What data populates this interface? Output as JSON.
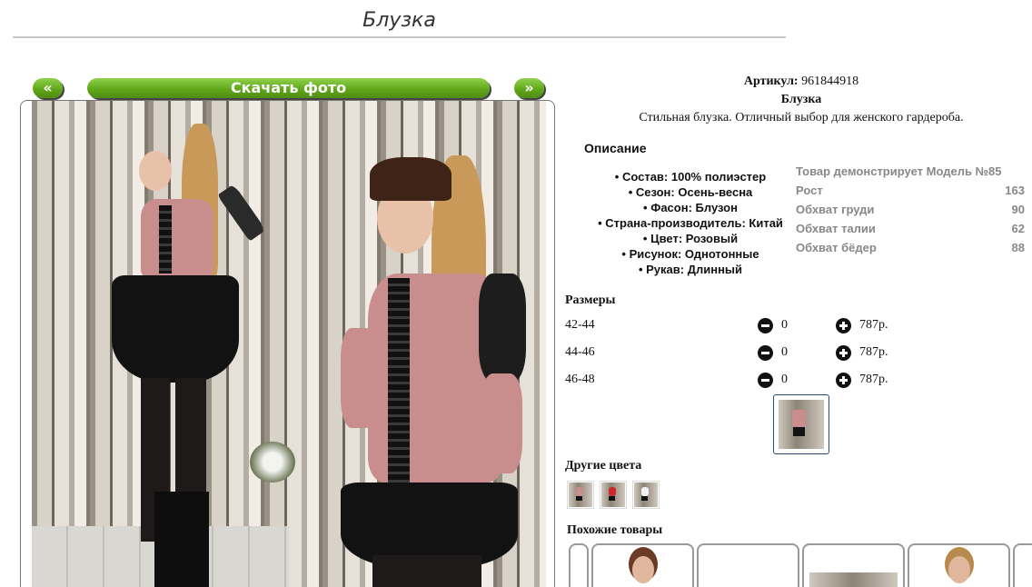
{
  "page": {
    "title": "Блузка"
  },
  "photo_nav": {
    "prev_label": "«",
    "download_label": "Скачать фото",
    "next_label": "»"
  },
  "product": {
    "article_label": "Артикул:",
    "article_value": "961844918",
    "name": "Блузка",
    "short_description": "Стильная блузка. Отличный выбор для женского гардероба."
  },
  "description": {
    "heading": "Описание",
    "properties": [
      "Состав: 100% полиэстер",
      "Сезон: Осень-весна",
      "Фасон: Блузон",
      "Страна-производитель: Китай",
      "Цвет: Розовый",
      "Рисунок: Однотонные",
      "Рукав: Длинный"
    ]
  },
  "model": {
    "heading": "Товар демонстрирует Модель №85",
    "rows": [
      {
        "label": "Рост",
        "value": "163"
      },
      {
        "label": "Обхват груди",
        "value": "90"
      },
      {
        "label": "Обхват талии",
        "value": "62"
      },
      {
        "label": "Обхват бёдер",
        "value": "88"
      }
    ]
  },
  "sizes": {
    "heading": "Размеры",
    "rows": [
      {
        "size": "42-44",
        "qty": "0",
        "price": "787р."
      },
      {
        "size": "44-46",
        "qty": "0",
        "price": "787р."
      },
      {
        "size": "46-48",
        "qty": "0",
        "price": "787р."
      }
    ]
  },
  "other_colors": {
    "heading": "Другие цвета"
  },
  "similar": {
    "heading": "Похожие товары"
  }
}
